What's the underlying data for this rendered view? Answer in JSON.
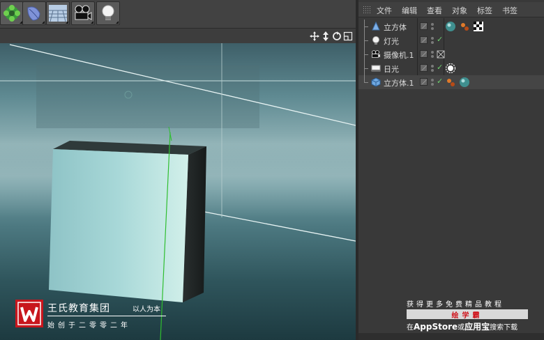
{
  "app": "Cinema 4D",
  "toolbar": {
    "buttons": [
      {
        "name": "mograph-cloner-button",
        "icon": "green-gear-icon"
      },
      {
        "name": "deformer-button",
        "icon": "blue-leaf-icon"
      },
      {
        "name": "environment-floor-button",
        "icon": "floor-grid-icon"
      },
      {
        "name": "camera-button",
        "icon": "film-camera-icon"
      },
      {
        "name": "light-button",
        "icon": "light-bulb-icon"
      }
    ]
  },
  "viewport": {
    "nav_icons": [
      "move-view-icon",
      "zoom-view-icon",
      "rotate-view-icon",
      "maximize-view-icon"
    ]
  },
  "object_manager": {
    "menus": [
      "文件",
      "编辑",
      "查看",
      "对象",
      "标签",
      "书签"
    ],
    "objects": [
      {
        "label": "立方体",
        "icon": "cone-icon",
        "checked": false,
        "tags": [
          "material-sphere-icon",
          "texture-dots-icon",
          "checkerboard-tag-icon"
        ]
      },
      {
        "label": "灯光",
        "icon": "light-bulb-icon",
        "checked": true,
        "tags": []
      },
      {
        "label": "摄像机.1",
        "icon": "camera-icon",
        "checked": false,
        "tags": [
          "protection-tag-icon"
        ]
      },
      {
        "label": "日光",
        "icon": "sun-light-icon",
        "checked": true,
        "tags": [
          "sun-tag-icon"
        ]
      },
      {
        "label": "立方体.1",
        "icon": "cube-icon",
        "checked": true,
        "tags": [
          "texture-dots-icon",
          "material-sphere-icon"
        ]
      }
    ],
    "checkmark": "✓"
  },
  "watermark": {
    "title": "王氏教育集团",
    "slogan": "以人为本",
    "subtitle": "始创于二零零二年"
  },
  "ad": {
    "line1": "获得更多免费精品教程",
    "bar": "绘学霸",
    "line3_prefix": "在",
    "line3_store": "AppStore",
    "line3_mid": "或",
    "line3_store2": "应用宝",
    "line3_suffix": "搜索下载"
  },
  "colors": {
    "watermark_red": "#c8161d",
    "check_green": "#6fd06f",
    "ad_red": "#d0141c"
  }
}
